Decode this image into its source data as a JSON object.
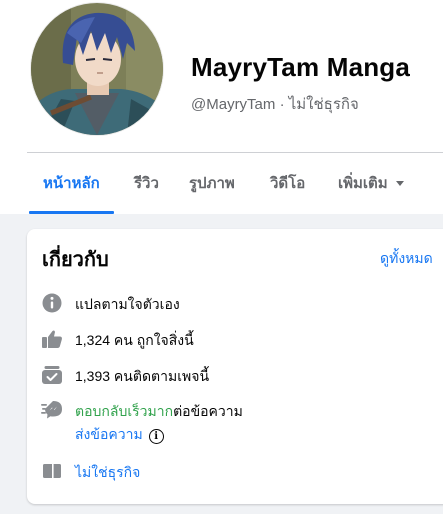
{
  "page": {
    "name": "MayryTam Manga",
    "handle": "@MayryTam",
    "separator": "·",
    "category": "ไม่ใช่ธุรกิจ"
  },
  "tabs": [
    {
      "label": "หน้าหลัก",
      "active": true
    },
    {
      "label": "รีวิว"
    },
    {
      "label": "รูปภาพ"
    },
    {
      "label": "วิดีโอ"
    },
    {
      "label": "เพิ่มเติม"
    }
  ],
  "about": {
    "title": "เกี่ยวกับ",
    "see_all": "ดูทั้งหมด",
    "description": "แปลตามใจตัวเอง",
    "likes": "1,324 คน ถูกใจสิ่งนี้",
    "followers": "1,393 คนติดตามเพจนี้",
    "response_fast": "ตอบกลับเร็วมาก",
    "response_rest": "ต่อข้อความ",
    "send_message": "ส่งข้อความ",
    "info_glyph": "i",
    "category": "ไม่ใช่ธุรกิจ"
  },
  "icons": {
    "row1": "info-icon",
    "row2": "thumbs-up-icon",
    "row3": "followers-check-icon",
    "row4": "messenger-fast-icon",
    "row5": "category-flag-icon"
  },
  "colors": {
    "accent": "#1877f2",
    "green": "#31a24c",
    "secondary_text": "#65676b",
    "icon_gray": "#8a8d91"
  }
}
